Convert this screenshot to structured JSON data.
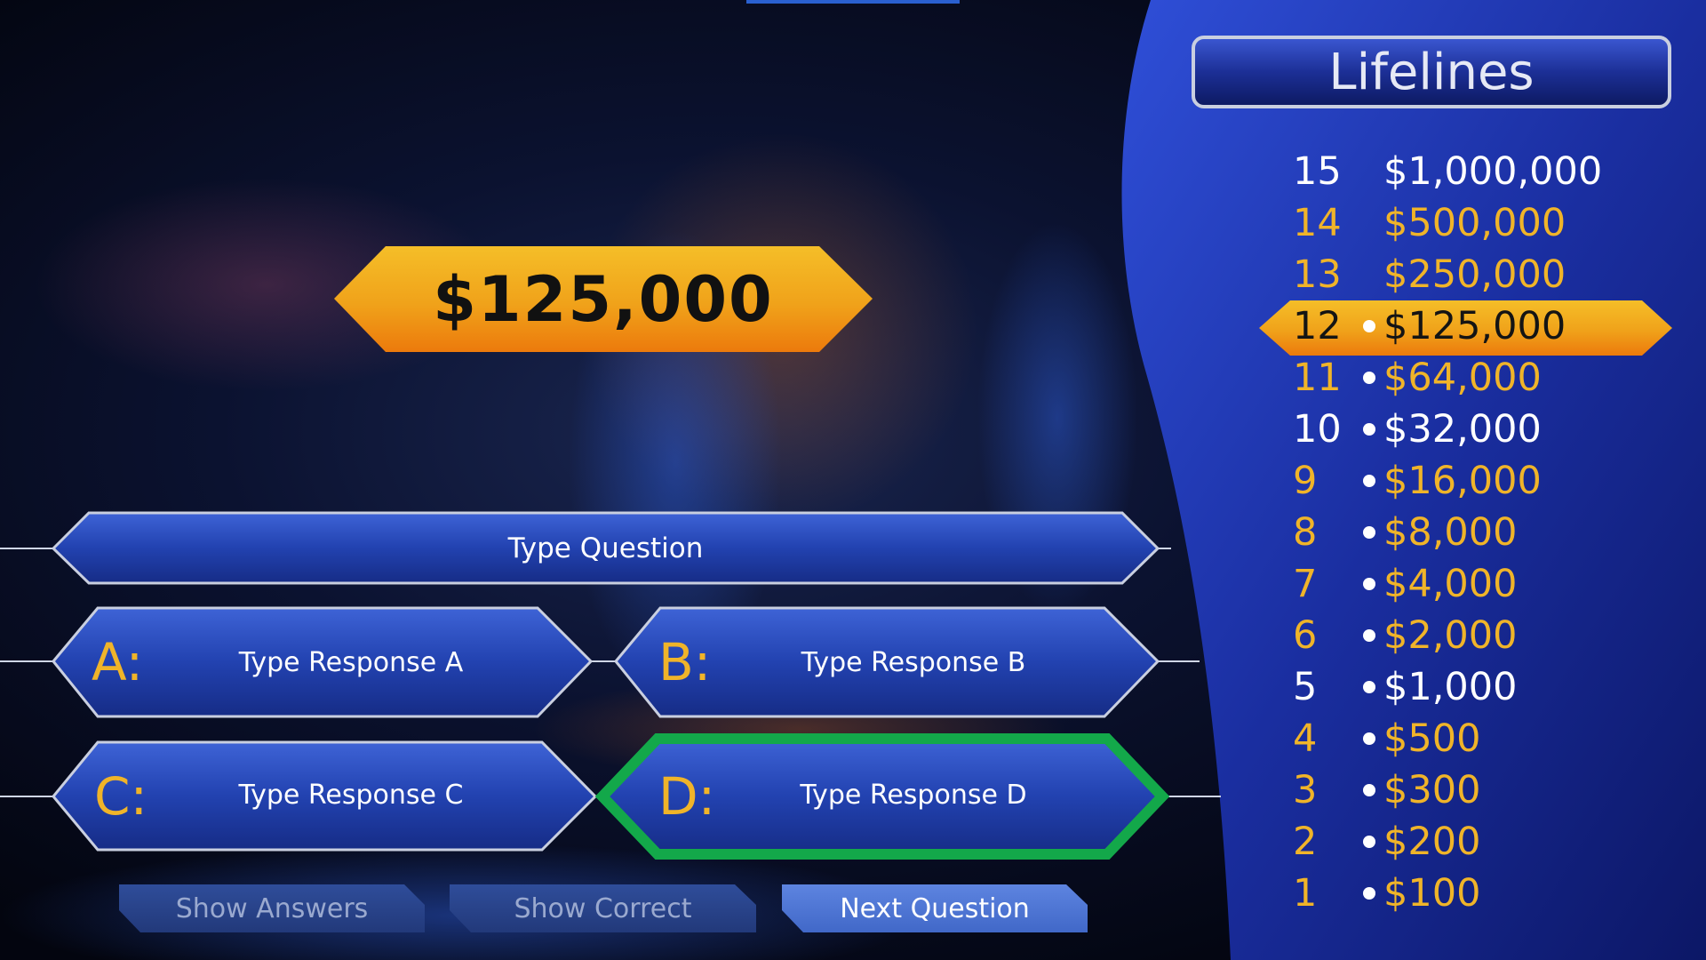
{
  "current_prize": "$125,000",
  "question": "Type Question",
  "answers": [
    {
      "letter": "A:",
      "text": "Type Response A"
    },
    {
      "letter": "B:",
      "text": "Type Response B"
    },
    {
      "letter": "C:",
      "text": "Type Response C"
    },
    {
      "letter": "D:",
      "text": "Type Response D",
      "state": "selected"
    }
  ],
  "controls": {
    "show_answers": "Show Answers",
    "show_correct": "Show Correct",
    "next_question": "Next Question"
  },
  "lifelines_label": "Lifelines",
  "ladder": [
    {
      "level": "15",
      "amount": "$1,000,000",
      "style": "white",
      "dot": false
    },
    {
      "level": "14",
      "amount": "$500,000",
      "style": "gold",
      "dot": false
    },
    {
      "level": "13",
      "amount": "$250,000",
      "style": "gold",
      "dot": false
    },
    {
      "level": "12",
      "amount": "$125,000",
      "style": "current",
      "dot": true
    },
    {
      "level": "11",
      "amount": "$64,000",
      "style": "gold",
      "dot": true
    },
    {
      "level": "10",
      "amount": "$32,000",
      "style": "white",
      "dot": true
    },
    {
      "level": "9",
      "amount": "$16,000",
      "style": "gold",
      "dot": true
    },
    {
      "level": "8",
      "amount": "$8,000",
      "style": "gold",
      "dot": true
    },
    {
      "level": "7",
      "amount": "$4,000",
      "style": "gold",
      "dot": true
    },
    {
      "level": "6",
      "amount": "$2,000",
      "style": "gold",
      "dot": true
    },
    {
      "level": "5",
      "amount": "$1,000",
      "style": "white",
      "dot": true
    },
    {
      "level": "4",
      "amount": "$500",
      "style": "gold",
      "dot": true
    },
    {
      "level": "3",
      "amount": "$300",
      "style": "gold",
      "dot": true
    },
    {
      "level": "2",
      "amount": "$200",
      "style": "gold",
      "dot": true
    },
    {
      "level": "1",
      "amount": "$100",
      "style": "gold",
      "dot": true
    }
  ],
  "colors": {
    "gold": "#f0b429",
    "selected_outline": "#13a84a",
    "panel_blue": "#1b2fa8"
  }
}
